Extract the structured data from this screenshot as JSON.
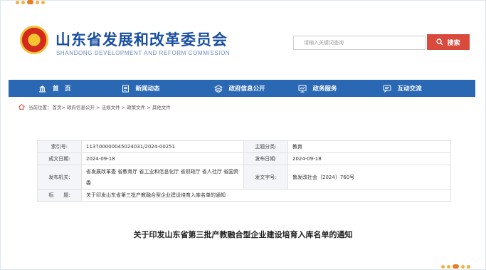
{
  "site": {
    "title": "山东省发展和改革委员会",
    "subtitle": "SHANDONG DEVELOPMENT AND REFORM COMMISSION"
  },
  "search": {
    "placeholder": "请输入关键词查询",
    "button_label": "搜索"
  },
  "nav": {
    "items": [
      {
        "label": "首　页",
        "icon": "home-icon"
      },
      {
        "label": "新闻动态",
        "icon": "news-icon"
      },
      {
        "label": "政府信息公开",
        "icon": "info-icon"
      },
      {
        "label": "政务服务",
        "icon": "service-icon"
      },
      {
        "label": "互动交流",
        "icon": "chat-icon"
      }
    ]
  },
  "breadcrumb": {
    "prefix": "当前位置：",
    "path": "首页> 政府信息公开 > 法规文件 > 政策文件 > 其他文件"
  },
  "meta": {
    "index_label": "索引号:",
    "index_value": "113700000045024031/2024-00251",
    "topic_label": "主题分类:",
    "topic_value": "教育",
    "created_label": "成文日期:",
    "created_value": "2024-09-18",
    "published_label": "发布日期:",
    "published_value": "2024-09-18",
    "issuer_label": "发布机关:",
    "issuer_value": "省发展改革委 省教育厅 省工业和信息化厅 省财政厅 省人社厅 省国资委",
    "docno_label": "发文字号:",
    "docno_value": "鲁发改社会〔2024〕760号",
    "title_label": "标　　题:",
    "title_value": "关于印发山东省第三批产教融合型企业建设培育入库名单的通知"
  },
  "document": {
    "heading": "关于印发山东省第三批产教融合型企业建设培育入库名单的通知"
  },
  "colors": {
    "brand_blue": "#1a4fa0",
    "nav_blue": "#2b68b4",
    "search_red": "#d94a3d"
  }
}
